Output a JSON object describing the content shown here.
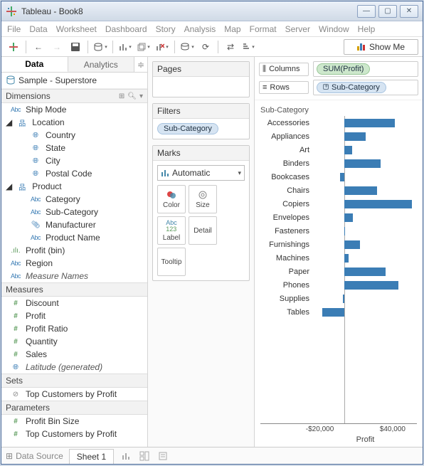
{
  "window": {
    "title": "Tableau - Book8"
  },
  "menu": [
    "File",
    "Data",
    "Worksheet",
    "Dashboard",
    "Story",
    "Analysis",
    "Map",
    "Format",
    "Server",
    "Window",
    "Help"
  ],
  "showme": "Show Me",
  "left_tabs": {
    "data": "Data",
    "analytics": "Analytics"
  },
  "datasource": "Sample - Superstore",
  "sections": {
    "dimensions": "Dimensions",
    "measures": "Measures",
    "sets": "Sets",
    "parameters": "Parameters"
  },
  "dimensions": {
    "ship_mode": "Ship Mode",
    "location": "Location",
    "country": "Country",
    "state": "State",
    "city": "City",
    "postal": "Postal Code",
    "product": "Product",
    "category": "Category",
    "subcategory": "Sub-Category",
    "manufacturer": "Manufacturer",
    "product_name": "Product Name",
    "profit_bin": "Profit (bin)",
    "region": "Region",
    "measure_names": "Measure Names"
  },
  "measures": {
    "discount": "Discount",
    "profit": "Profit",
    "profit_ratio": "Profit Ratio",
    "quantity": "Quantity",
    "sales": "Sales",
    "latitude": "Latitude (generated)"
  },
  "sets": {
    "top_customers": "Top Customers by Profit"
  },
  "parameters": {
    "profit_bin_size": "Profit Bin Size",
    "top_customers": "Top Customers"
  },
  "cards": {
    "pages": "Pages",
    "filters": "Filters",
    "filters_pill": "Sub-Category",
    "marks": "Marks",
    "marks_type": "Automatic",
    "color": "Color",
    "size": "Size",
    "label": "Label",
    "detail": "Detail",
    "tooltip": "Tooltip"
  },
  "shelves": {
    "columns": "Columns",
    "rows": "Rows",
    "columns_pill": "SUM(Profit)",
    "rows_pill": "Sub-Category"
  },
  "bottom": {
    "datasource": "Data Source",
    "sheet": "Sheet 1"
  },
  "chart_data": {
    "type": "bar",
    "title": "Sub-Category",
    "xlabel": "Profit",
    "xticks": [
      -20000,
      40000
    ],
    "xtick_labels": [
      "-$20,000",
      "$40,000"
    ],
    "xlim": [
      -25000,
      60000
    ],
    "categories": [
      "Accessories",
      "Appliances",
      "Art",
      "Binders",
      "Bookcases",
      "Chairs",
      "Copiers",
      "Envelopes",
      "Fasteners",
      "Furnishings",
      "Machines",
      "Paper",
      "Phones",
      "Supplies",
      "Tables"
    ],
    "values": [
      42000,
      18000,
      6500,
      30000,
      -3500,
      27000,
      56000,
      7000,
      1000,
      13000,
      3500,
      34000,
      45000,
      -1200,
      -18000
    ]
  }
}
